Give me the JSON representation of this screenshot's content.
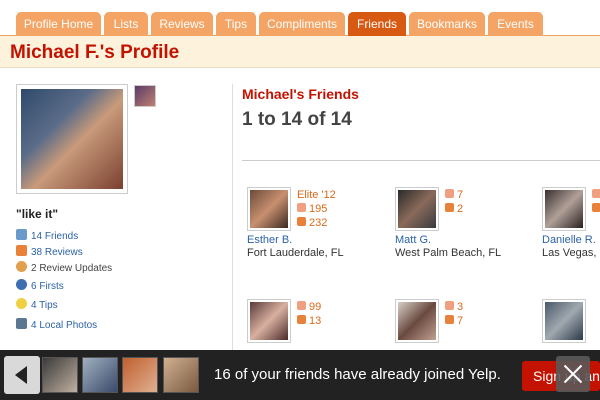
{
  "tabs": [
    {
      "label": "Profile Home",
      "active": false
    },
    {
      "label": "Lists",
      "active": false
    },
    {
      "label": "Reviews",
      "active": false
    },
    {
      "label": "Tips",
      "active": false
    },
    {
      "label": "Compliments",
      "active": false
    },
    {
      "label": "Friends",
      "active": true
    },
    {
      "label": "Bookmarks",
      "active": false
    },
    {
      "label": "Events",
      "active": false
    }
  ],
  "page_title": "Michael F.'s Profile",
  "profile": {
    "quote": "\"like it\"",
    "stats": [
      {
        "icon": "friends-icon",
        "text": "14 Friends",
        "link": true
      },
      {
        "icon": "review-icon",
        "text": "38 Reviews",
        "link": true
      },
      {
        "icon": "update-icon",
        "text": "2 Review Updates",
        "link": false
      },
      {
        "icon": "first-icon",
        "text": "6 Firsts",
        "link": true
      },
      {
        "icon": "tip-icon",
        "text": "4 Tips",
        "link": true
      },
      {
        "icon": "camera-icon",
        "text": "4 Local Photos",
        "link": true
      }
    ]
  },
  "friends": {
    "heading": "Michael's Friends",
    "range": "1 to 14 of 14",
    "cards": [
      {
        "name": "Esther B.",
        "location": "Fort Lauderdale, FL",
        "elite": "Elite '12",
        "friends": "195",
        "reviews": "232"
      },
      {
        "name": "Matt G.",
        "location": "West Palm Beach, FL",
        "elite": "",
        "friends": "7",
        "reviews": "2"
      },
      {
        "name": "Danielle R.",
        "location": "Las Vegas, NV",
        "elite": "",
        "friends": "",
        "reviews": ""
      },
      {
        "name": "",
        "location": "",
        "elite": "",
        "friends": "99",
        "reviews": "13"
      },
      {
        "name": "",
        "location": "",
        "elite": "",
        "friends": "3",
        "reviews": "7"
      },
      {
        "name": "",
        "location": "",
        "elite": "",
        "friends": "",
        "reviews": ""
      }
    ]
  },
  "banner": {
    "message": "16 of your friends have already joined Yelp.",
    "signup_label": "Sign up and"
  }
}
